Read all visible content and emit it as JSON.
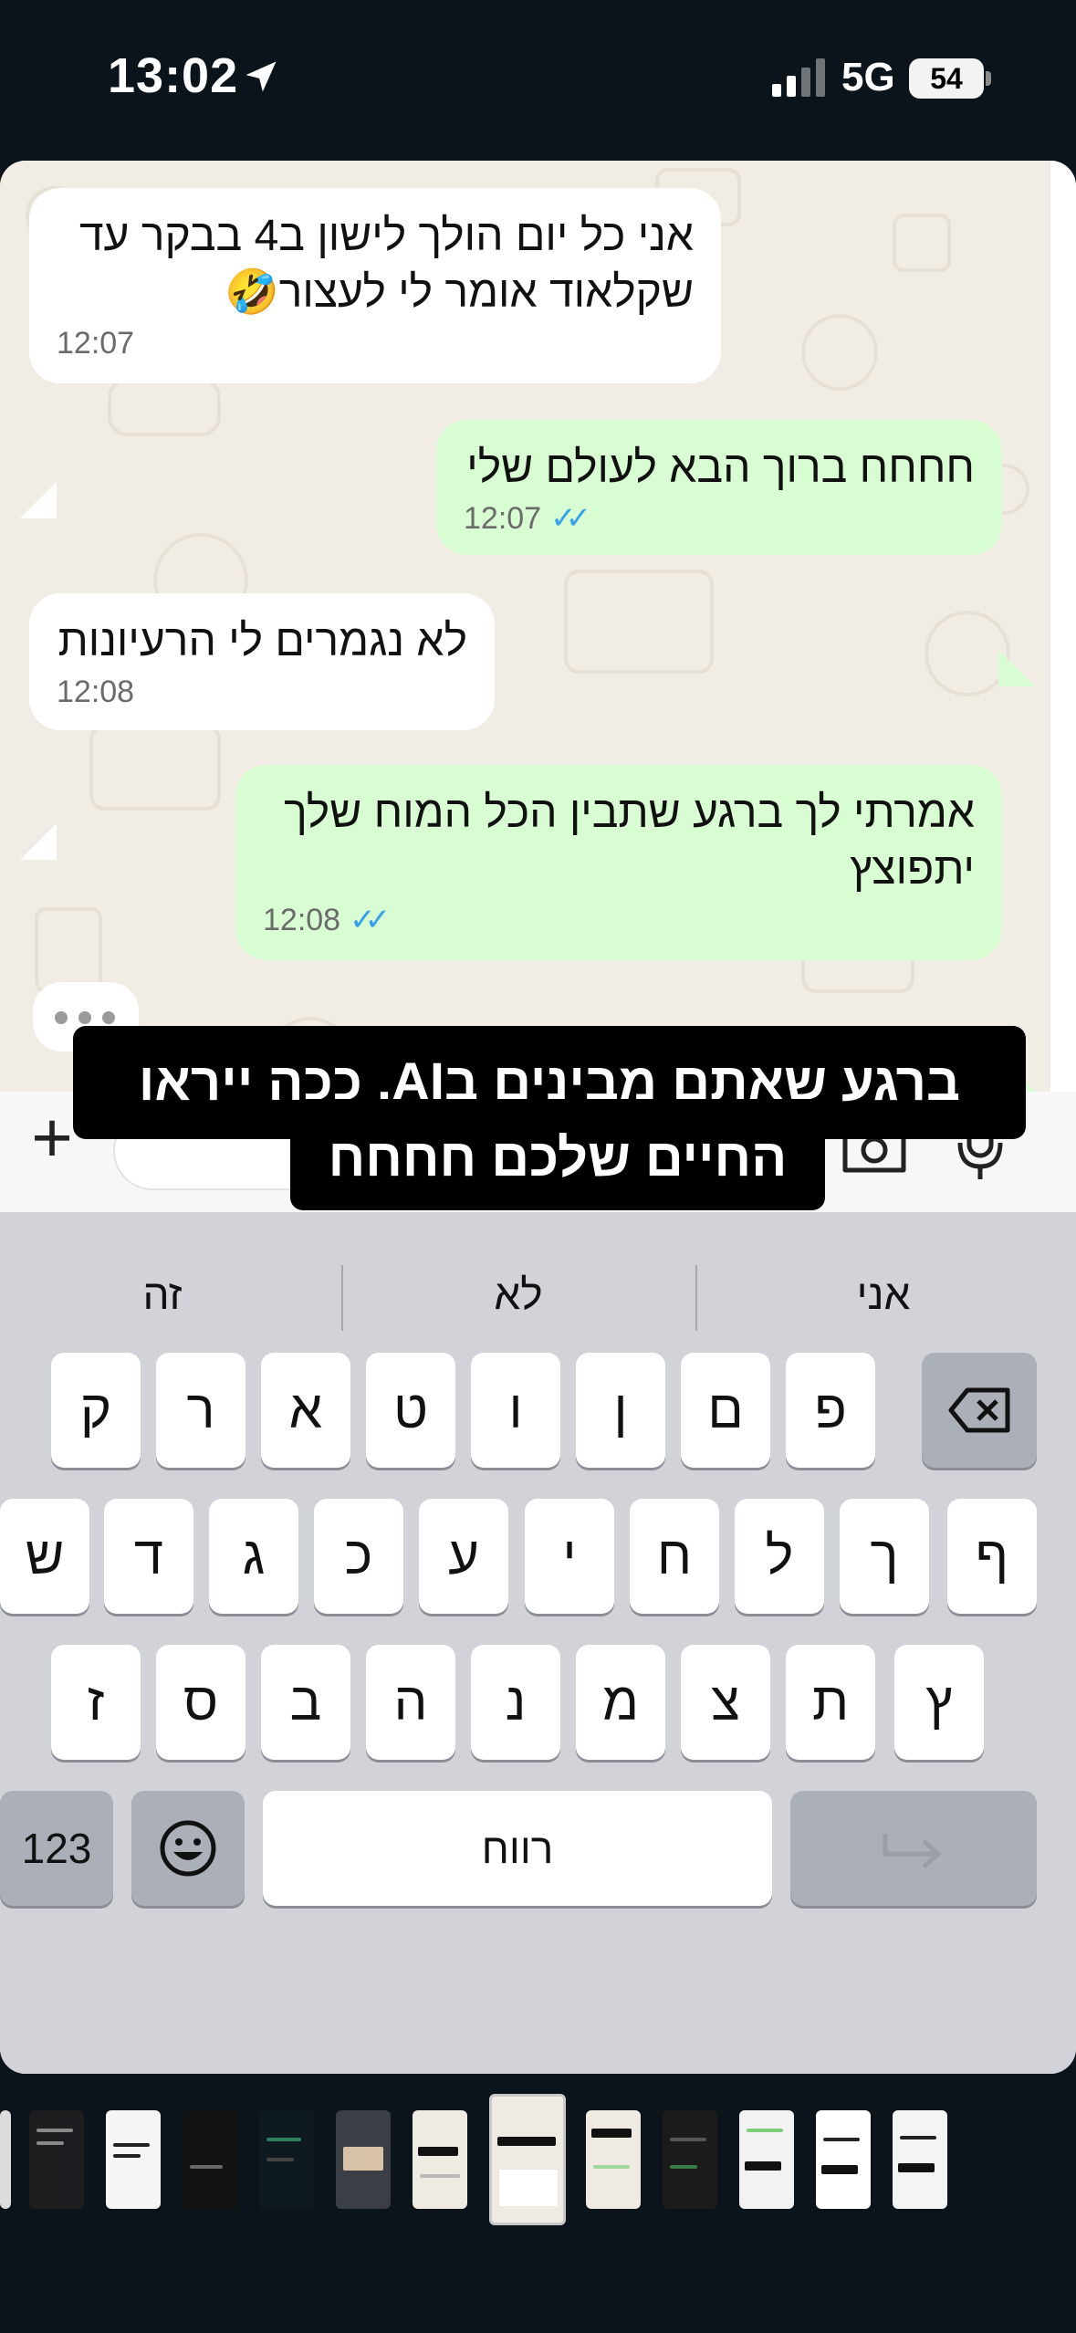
{
  "status_bar": {
    "time": "13:02",
    "network": "5G",
    "battery": "54"
  },
  "chat": {
    "messages": [
      {
        "direction": "in",
        "lines": [
          "אני כל יום הולך לישון ב4 בבקר עד",
          "שקלאוד אומר לי לעצור🤣"
        ],
        "time": "12:07"
      },
      {
        "direction": "out",
        "lines": [
          "חחחח ברוך הבא לעולם שלי"
        ],
        "time": "12:07",
        "status": "read"
      },
      {
        "direction": "in",
        "lines": [
          "לא נגמרים לי הרעיונות"
        ],
        "time": "12:08"
      },
      {
        "direction": "out",
        "lines": [
          "אמרתי לך ברגע שתבין הכל המוח שלך",
          "יתפוצץ"
        ],
        "time": "12:08",
        "status": "read"
      }
    ],
    "typing_indicator": "•••"
  },
  "caption": {
    "line1": "ברגע שאתם מבינים בAI, ככה ייראו",
    "line2": "החיים שלכם חחחח"
  },
  "keyboard": {
    "suggestions": [
      "אני",
      "לא",
      "זה"
    ],
    "row1": [
      "ק",
      "ר",
      "א",
      "ט",
      "ו",
      "ן",
      "ם",
      "פ"
    ],
    "row2": [
      "ש",
      "ד",
      "ג",
      "כ",
      "ע",
      "י",
      "ח",
      "ל",
      "ך",
      "ף"
    ],
    "row3": [
      "ז",
      "ס",
      "ב",
      "ה",
      "נ",
      "מ",
      "צ",
      "ת",
      "ץ"
    ],
    "numbers_label": "123",
    "space_label": "רווח"
  },
  "icons": {
    "plus": "+",
    "emoji": "emoji-icon",
    "camera": "camera-icon",
    "mic": "microphone-icon",
    "globe": "globe-icon",
    "delete": "delete-icon",
    "return": "return-icon"
  },
  "colors": {
    "incoming_bubble": "#ffffff",
    "outgoing_bubble": "#d9fdd3",
    "read_ticks": "#36a3e8",
    "chat_background": "#f1ece4",
    "keyboard_background": "#d1d3d9"
  }
}
